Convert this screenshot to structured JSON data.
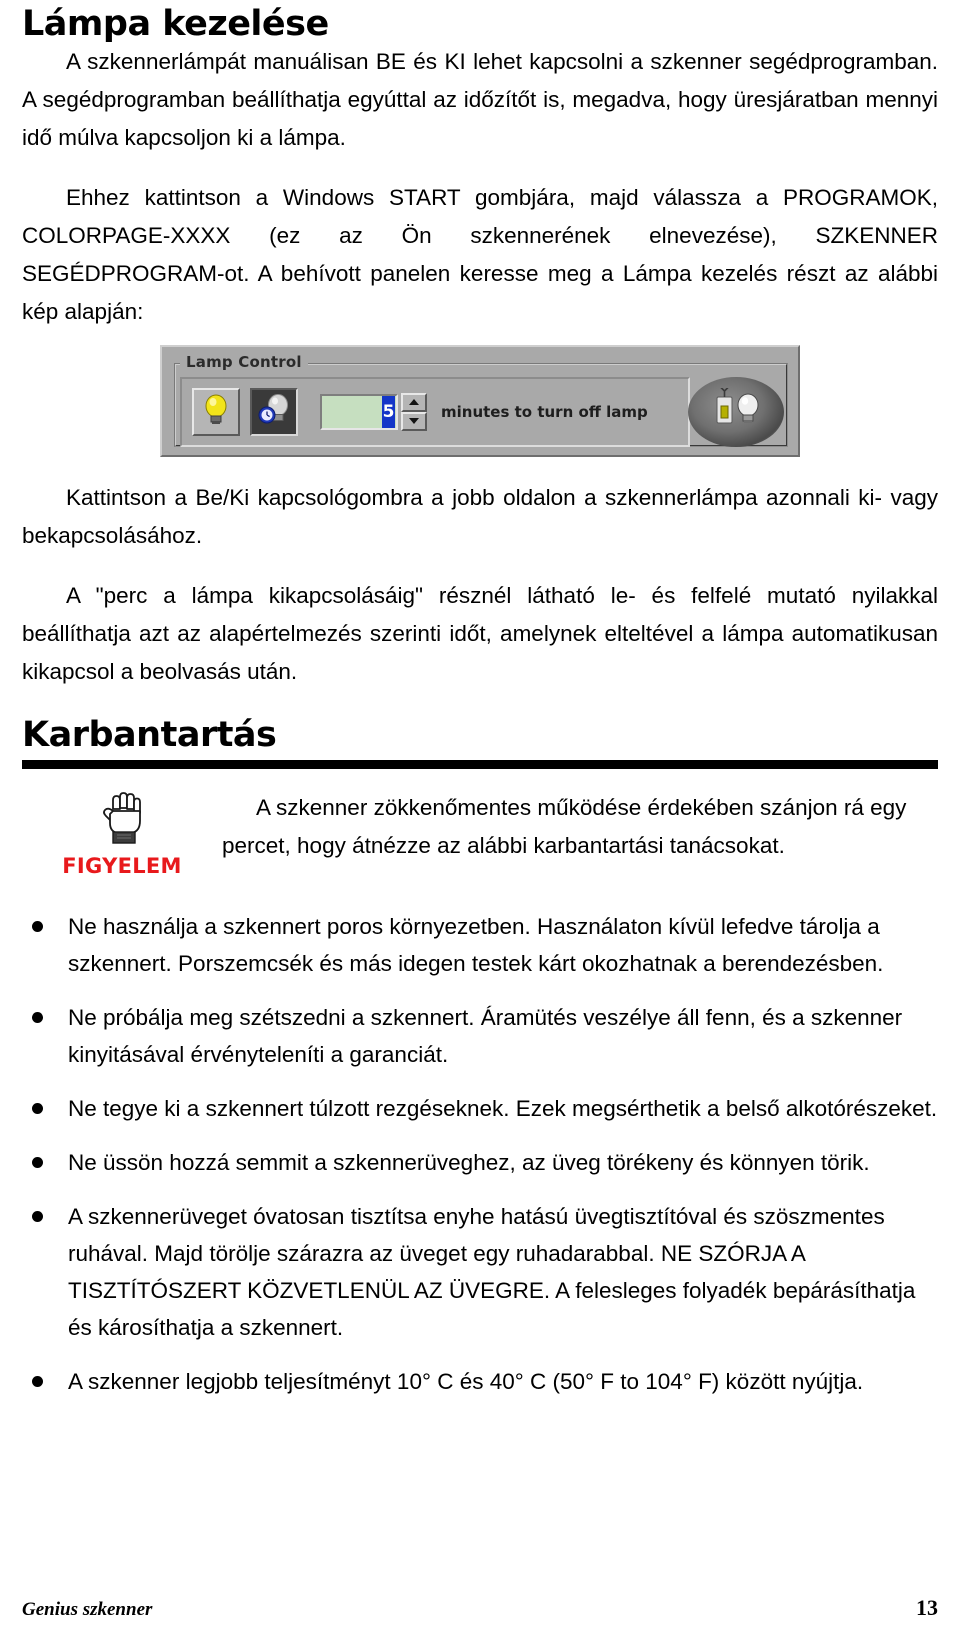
{
  "document": {
    "heading_lamp": "Lámpa kezelése",
    "heading_maintenance": "Karbantartás"
  },
  "paragraphs": {
    "p1": "A szkennerlámpát manuálisan BE és KI lehet kapcsolni a szkenner segédprogramban. A segédprogramban beállíthatja egyúttal az időzítőt is, megadva, hogy üresjáratban mennyi idő múlva kapcsoljon ki a lámpa.",
    "p2": "Ehhez kattintson a Windows START gombjára, majd válassza a PROGRAMOK, COLORPAGE-XXXX (ez az Ön szkennerének elnevezése), SZKENNER SEGÉDPROGRAM-ot. A behívott panelen keresse meg a Lámpa kezelés részt az alábbi kép alapján:",
    "p3": "Kattintson a Be/Ki kapcsológombra a jobb oldalon a szkennerlámpa azonnali ki- vagy bekapcsolásához.",
    "p4": "A \"perc a lámpa kikapcsolásáig\" résznél látható le- és felfelé mutató nyilakkal beállíthatja azt az alapértelmezés szerinti időt, amelynek elteltével a lámpa automatikusan kikapcsol a beolvasás után."
  },
  "lamp_control_figure": {
    "group_title": "Lamp Control",
    "lamp_on_button_icon": "lightbulb-yellow-icon",
    "lamp_timer_button_icon": "lightbulb-clock-icon",
    "timer_value": "5",
    "timer_label": "minutes to turn off lamp",
    "spin_up_icon": "triangle-up-icon",
    "spin_down_icon": "triangle-down-icon",
    "onoff_button_icon": "switch-lightbulb-icon"
  },
  "warning": {
    "icon": "stop-hand-icon",
    "label": "FIGYELEM",
    "label_color": "#e8191c",
    "line1": "A szkenner zökkenőmentes működése érdekében szánjon rá egy",
    "line2": "percet, hogy átnézze az alábbi karbantartási tanácsokat."
  },
  "tips": [
    "Ne használja a szkennert poros környezetben. Használaton kívül lefedve tárolja a szkennert. Porszemcsék és más idegen testek kárt okozhatnak a berendezésben.",
    "Ne próbálja meg szétszedni a szkennert. Áramütés veszélye áll fenn, és a szkenner kinyitásával érvényteleníti a garanciát.",
    "Ne tegye ki a szkennert túlzott rezgéseknek. Ezek megsérthetik a belső alkotórészeket.",
    "Ne üssön hozzá semmit a szkennerüveghez, az üveg törékeny és könnyen törik.",
    "A szkennerüveget óvatosan tisztítsa enyhe hatású üvegtisztítóval és szöszmentes ruhával. Majd törölje szárazra az üveget egy ruhadarabbal. NE SZÓRJA A TISZTÍTÓSZERT KÖZVETLENÜL AZ ÜVEGRE. A felesleges folyadék bepárásíthatja és károsíthatja a szkennert.",
    "A szkenner legjobb teljesítményt 10° C és 40° C (50° F to 104° F) között nyújtja."
  ],
  "footer": {
    "left": "Genius szkenner",
    "page_number": "13"
  }
}
